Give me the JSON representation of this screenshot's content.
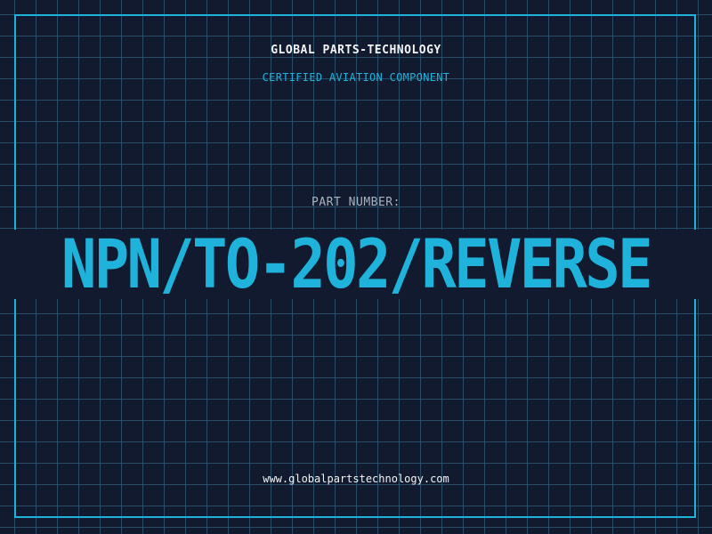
{
  "header": {
    "company": "GLOBAL PARTS-TECHNOLOGY",
    "tagline": "CERTIFIED AVIATION COMPONENT"
  },
  "part": {
    "label": "PART NUMBER:",
    "number": "NPN/TO-202/REVERSE"
  },
  "footer": {
    "website": "www.globalpartstechnology.com"
  },
  "colors": {
    "background": "#111a2e",
    "grid": "#2a5670",
    "accent": "#1fb3dc",
    "text": "#f2f4f6",
    "muted": "#a9b3bf"
  }
}
